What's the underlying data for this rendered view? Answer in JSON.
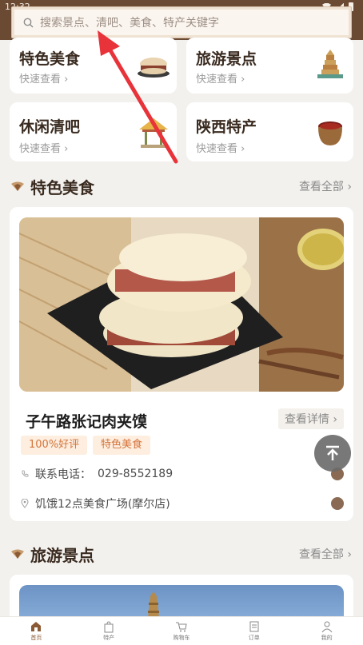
{
  "status_bar": {
    "time": "12:32"
  },
  "search": {
    "placeholder": "搜索景点、清吧、美食、特产关键字"
  },
  "categories": [
    {
      "title": "特色美食",
      "subtitle": "快速查看"
    },
    {
      "title": "旅游景点",
      "subtitle": "快速查看"
    },
    {
      "title": "休闲清吧",
      "subtitle": "快速查看"
    },
    {
      "title": "陕西特产",
      "subtitle": "快速查看"
    }
  ],
  "sections": {
    "food": {
      "title": "特色美食",
      "see_all": "查看全部"
    },
    "scenic": {
      "title": "旅游景点",
      "see_all": "查看全部"
    }
  },
  "featured": {
    "name": "子午路张记肉夹馍",
    "detail_label": "查看详情",
    "tags": [
      "100%好评",
      "特色美食"
    ],
    "phone_label": "联系电话：",
    "phone": "029-8552189",
    "address": "饥饿12点美食广场(摩尔店)"
  },
  "bottom_nav": [
    {
      "label": "首页",
      "icon": "home-icon"
    },
    {
      "label": "特产",
      "icon": "bag-icon"
    },
    {
      "label": "购物车",
      "icon": "cart-icon"
    },
    {
      "label": "订单",
      "icon": "order-icon"
    },
    {
      "label": "我的",
      "icon": "user-icon"
    }
  ],
  "colors": {
    "brand_brown": "#6b4a34",
    "accent_orange": "#d4743a",
    "tag_bg": "#fdeee0",
    "annotation_red": "#e8333a"
  }
}
